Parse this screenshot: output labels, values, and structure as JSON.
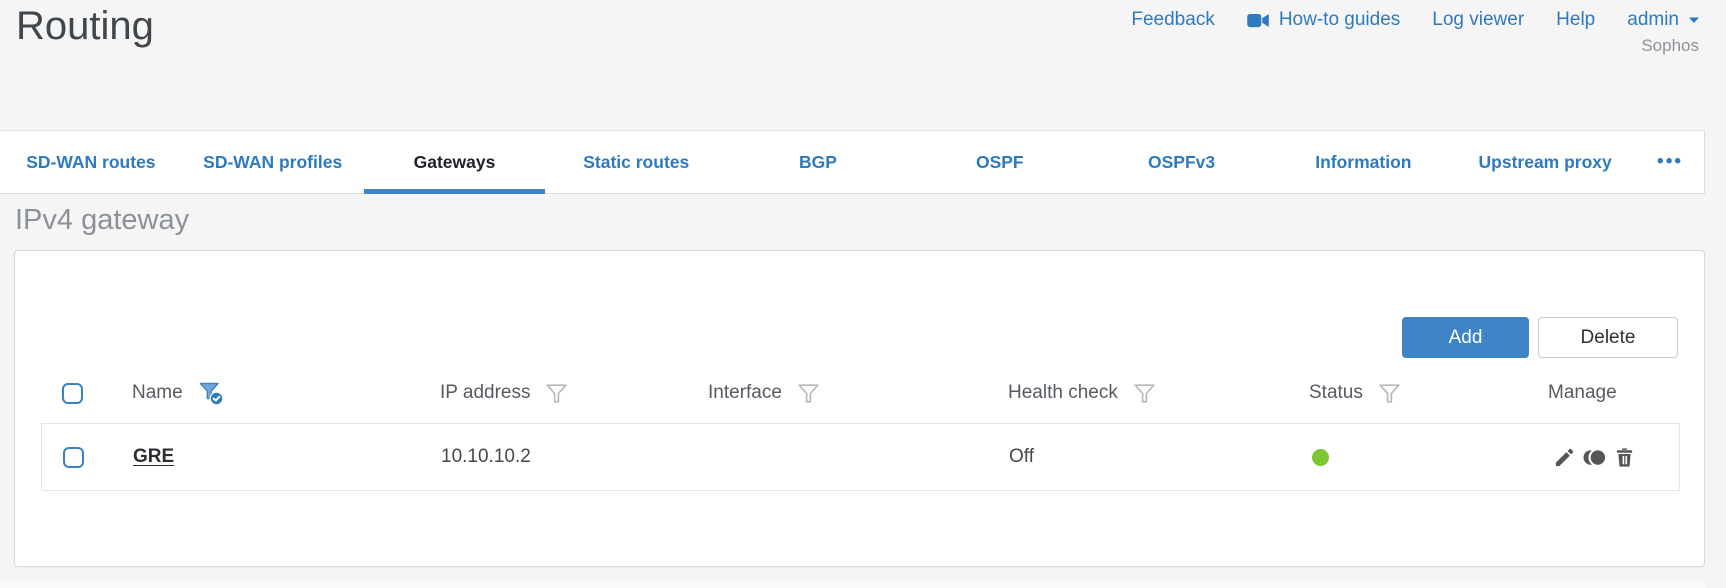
{
  "page": {
    "title": "Routing",
    "brand": "Sophos",
    "more_tabs": "•••"
  },
  "header_links": {
    "feedback": "Feedback",
    "howto_guides": "How-to guides",
    "log_viewer": "Log viewer",
    "help": "Help",
    "user": "admin"
  },
  "tabs": [
    {
      "label": "SD-WAN routes",
      "active": false
    },
    {
      "label": "SD-WAN profiles",
      "active": false
    },
    {
      "label": "Gateways",
      "active": true
    },
    {
      "label": "Static routes",
      "active": false
    },
    {
      "label": "BGP",
      "active": false
    },
    {
      "label": "OSPF",
      "active": false
    },
    {
      "label": "OSPFv3",
      "active": false
    },
    {
      "label": "Information",
      "active": false
    },
    {
      "label": "Upstream proxy",
      "active": false
    }
  ],
  "section": {
    "title": "IPv4 gateway"
  },
  "toolbar": {
    "add_label": "Add",
    "delete_label": "Delete"
  },
  "table": {
    "columns": [
      {
        "label": "Name",
        "filter": "active"
      },
      {
        "label": "IP address",
        "filter": "default"
      },
      {
        "label": "Interface",
        "filter": "default"
      },
      {
        "label": "Health check",
        "filter": "default"
      },
      {
        "label": "Status",
        "filter": "default"
      },
      {
        "label": "Manage",
        "filter": "none"
      }
    ],
    "rows": [
      {
        "name": "GRE",
        "ip_address": "10.10.10.2",
        "interface": "",
        "health_check": "Off",
        "status": "up"
      }
    ]
  },
  "colors": {
    "accent_blue": "#2e7abf",
    "button_blue": "#3e83c5",
    "status_green": "#7dc832",
    "section_title_gray": "#8b9197",
    "text_dark": "#2b2f33"
  }
}
